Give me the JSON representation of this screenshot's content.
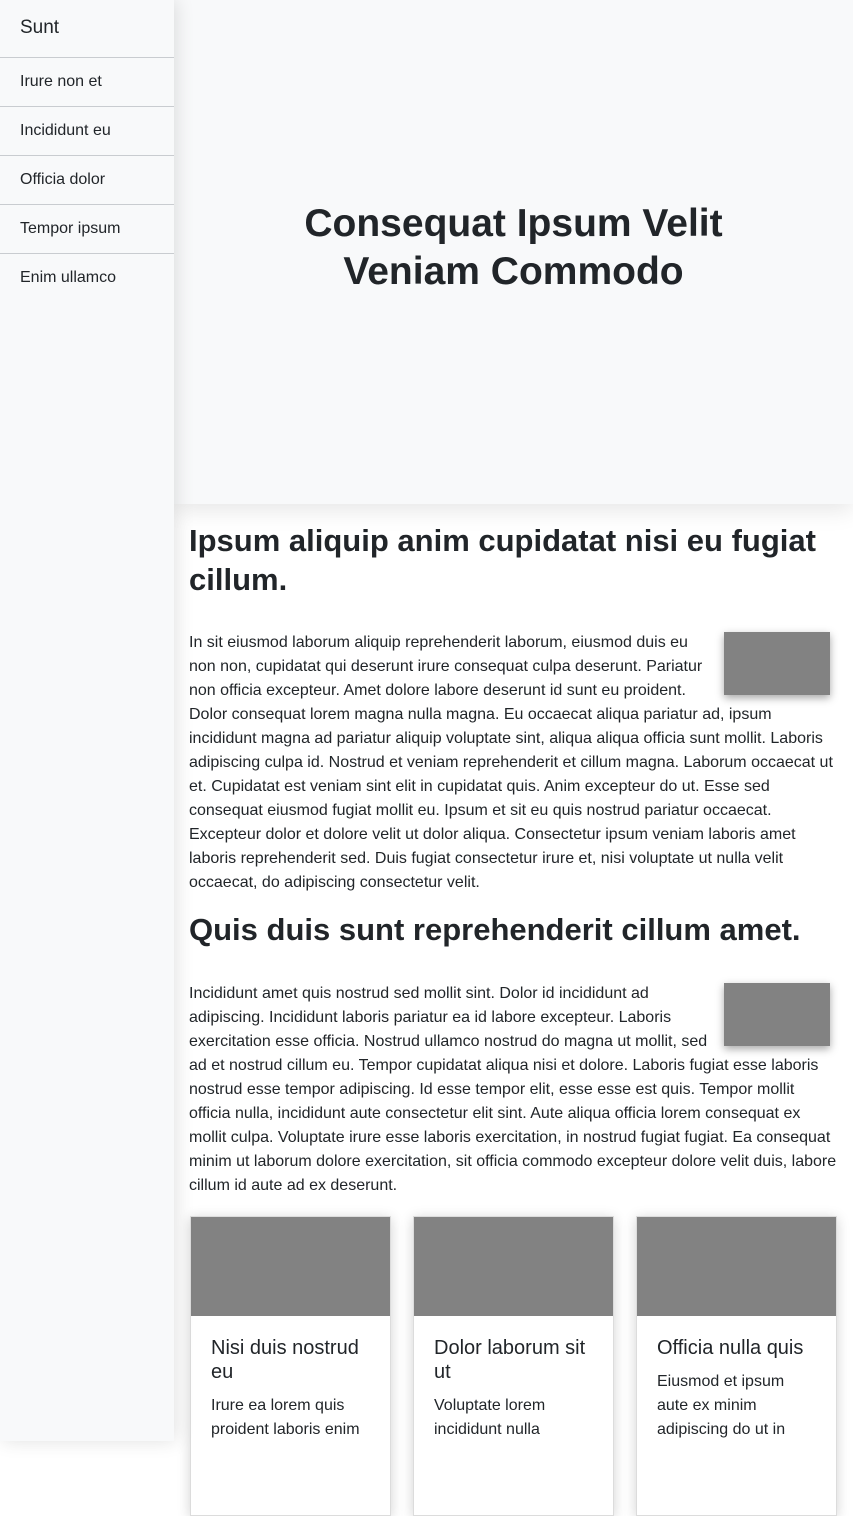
{
  "sidebar": {
    "brand": "Sunt",
    "items": [
      {
        "label": "Irure non et"
      },
      {
        "label": "Incididunt eu"
      },
      {
        "label": "Officia dolor"
      },
      {
        "label": "Tempor ipsum"
      },
      {
        "label": "Enim ullamco"
      }
    ]
  },
  "hero": {
    "title": "Consequat Ipsum Velit Veniam Commodo"
  },
  "sections": [
    {
      "title": "Ipsum aliquip anim cupidatat nisi eu fugiat cillum.",
      "body": "In sit eiusmod laborum aliquip reprehenderit laborum, eiusmod duis eu non non, cupidatat qui deserunt irure consequat culpa deserunt. Pariatur non officia excepteur. Amet dolore labore deserunt id sunt eu proident. Dolor consequat lorem magna nulla magna. Eu occaecat aliqua pariatur ad, ipsum incididunt magna ad pariatur aliquip voluptate sint, aliqua aliqua officia sunt mollit. Laboris adipiscing culpa id. Nostrud et veniam reprehenderit et cillum magna. Laborum occaecat ut et. Cupidatat est veniam sint elit in cupidatat quis. Anim excepteur do ut. Esse sed consequat eiusmod fugiat mollit eu. Ipsum et sit eu quis nostrud pariatur occaecat. Excepteur dolor et dolore velit ut dolor aliqua. Consectetur ipsum veniam laboris amet laboris reprehenderit sed. Duis fugiat consectetur irure et, nisi voluptate ut nulla velit occaecat, do adipiscing consectetur velit."
    },
    {
      "title": "Quis duis sunt reprehenderit cillum amet.",
      "body": "Incididunt amet quis nostrud sed mollit sint. Dolor id incididunt ad adipiscing. Incididunt laboris pariatur ea id labore excepteur. Laboris exercitation esse officia. Nostrud ullamco nostrud do magna ut mollit, sed ad et nostrud cillum eu. Tempor cupidatat aliqua nisi et dolore. Laboris fugiat esse laboris nostrud esse tempor adipiscing. Id esse tempor elit, esse esse est quis. Tempor mollit officia nulla, incididunt aute consectetur elit sint. Aute aliqua officia lorem consequat ex mollit culpa. Voluptate irure esse laboris exercitation, in nostrud fugiat fugiat. Ea consequat minim ut laborum dolore exercitation, sit officia commodo excepteur dolore velit duis, labore cillum id aute ad ex deserunt."
    }
  ],
  "cards": [
    {
      "title": "Nisi duis nostrud eu",
      "text": "Irure ea lorem quis proident laboris enim"
    },
    {
      "title": "Dolor laborum sit ut",
      "text": "Voluptate lorem incididunt nulla"
    },
    {
      "title": "Officia nulla quis",
      "text": "Eiusmod et ipsum aute ex minim adipiscing do ut in"
    }
  ],
  "colors": {
    "sidebar_bg": "#f8f9fa",
    "hero_bg": "#f8f9fa",
    "placeholder_image": "#828282",
    "text": "#212529"
  }
}
